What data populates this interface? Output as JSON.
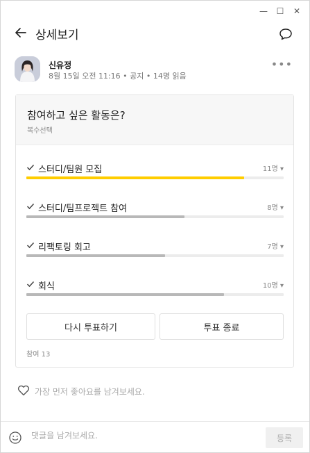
{
  "window_controls": {
    "minimize": "—",
    "maximize": "☐",
    "close": "✕"
  },
  "header": {
    "title": "상세보기"
  },
  "post": {
    "author": "신유정",
    "meta": "8월 15일 오전 11:16 • 공지 • 14명 읽음"
  },
  "poll": {
    "question": "참여하고 싶은 활동은?",
    "subtitle": "복수선택",
    "options": [
      {
        "label": "스터디/팀원 모집",
        "count": "11명",
        "value": 11,
        "color": "#ffcd00"
      },
      {
        "label": "스터디/팀프로젝트 참여",
        "count": "8명",
        "value": 8,
        "color": "#b8b8b8"
      },
      {
        "label": "리팩토링 회고",
        "count": "7명",
        "value": 7,
        "color": "#b8b8b8"
      },
      {
        "label": "회식",
        "count": "10명",
        "value": 10,
        "color": "#b8b8b8"
      }
    ],
    "revote_label": "다시 투표하기",
    "end_label": "투표 종료",
    "participants": "참여 13",
    "total": 13
  },
  "like": {
    "text": "가장 먼저 좋아요를 남겨보세요."
  },
  "comment": {
    "placeholder": "댓글을 남겨보세요.",
    "submit_label": "등록"
  },
  "colors": {
    "accent": "#ffcd00",
    "bar_gray": "#b8b8b8"
  }
}
